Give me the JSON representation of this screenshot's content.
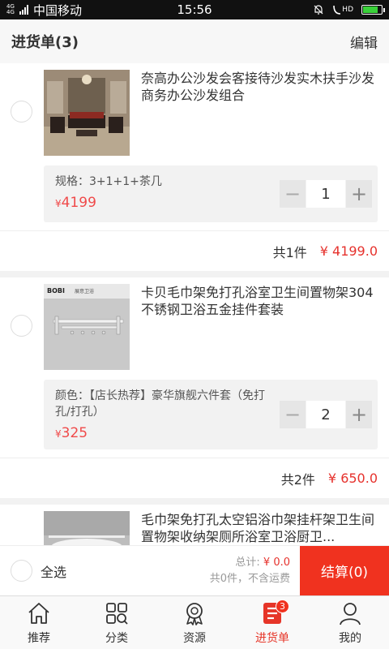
{
  "status_bar": {
    "network": "4G 4G",
    "carrier": "中国移动",
    "time": "15:56",
    "hd": "HD",
    "battery_level": 0.8
  },
  "header": {
    "title": "进货单(3)",
    "edit_label": "编辑"
  },
  "items": [
    {
      "name": "奈高办公沙发会客接待沙发实木扶手沙发商务办公沙发组合",
      "spec_label": "规格：",
      "spec_value": "3+1+1+茶几",
      "price_symbol": "¥",
      "price": "4199",
      "quantity": "1",
      "subtotal_count": "共1件",
      "subtotal_amount": "¥ 4199.0"
    },
    {
      "name": "卡贝毛巾架免打孔浴室卫生间置物架304不锈钢卫浴五金挂件套装",
      "thumb_brand": "BOBI",
      "thumb_brand_cn": "展意卫浴",
      "spec_label": "颜色：",
      "spec_value": "【店长热荐】豪华旗舰六件套（免打孔/打孔）",
      "price_symbol": "¥",
      "price": "325",
      "quantity": "2",
      "subtotal_count": "共2件",
      "subtotal_amount": "¥ 650.0"
    },
    {
      "name": "毛巾架免打孔太空铝浴巾架挂杆架卫生间置物架收纳架厕所浴室卫浴厨卫..."
    }
  ],
  "checkout": {
    "select_all_label": "全选",
    "total_label": "总计:",
    "total_value": "¥ 0.0",
    "count_note": "共0件，不含运费",
    "settle_label": "结算(0)"
  },
  "tabs": [
    {
      "label": "推荐",
      "icon": "home-icon"
    },
    {
      "label": "分类",
      "icon": "category-grid-icon"
    },
    {
      "label": "资源",
      "icon": "award-ribbon-icon"
    },
    {
      "label": "进货单",
      "icon": "order-list-icon",
      "badge": "3",
      "active": true
    },
    {
      "label": "我的",
      "icon": "user-icon"
    }
  ],
  "colors": {
    "accent": "#f0321f",
    "price": "#f04a4a",
    "active_tab": "#e63528"
  }
}
